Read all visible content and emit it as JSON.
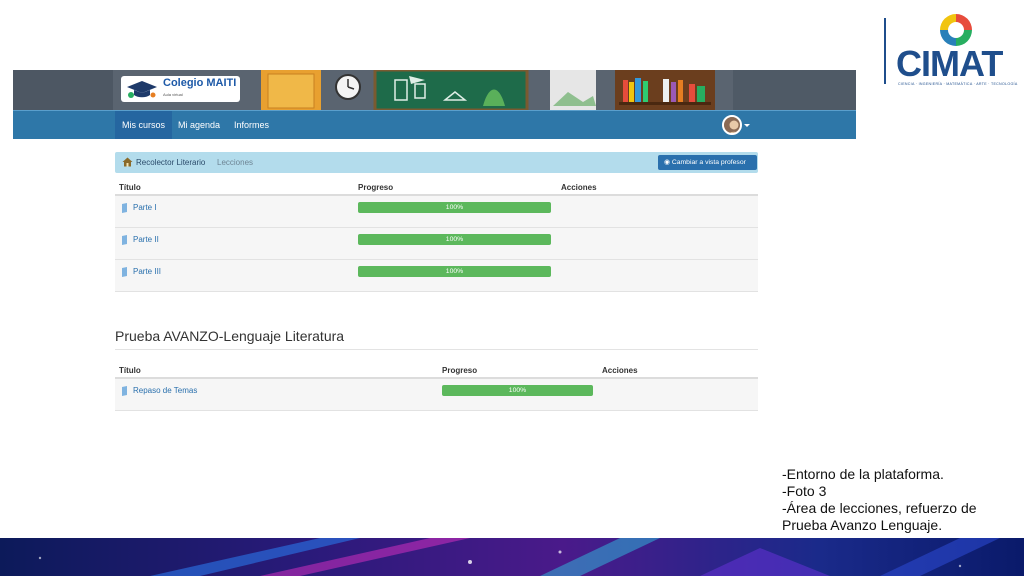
{
  "brand": {
    "logo_text": "CIMAT",
    "tagline": "CIENCIA · INGENIERÍA · MATEMÁTICA · ARTE · TECNOLOGÍA",
    "colors": {
      "primary": "#1f4e8c",
      "nav": "#2e77a8",
      "progress": "#5cb85c",
      "breadcrumb": "#b3dcec"
    }
  },
  "school": {
    "name": "Colegio MAITI",
    "subtitle": "Aula virtual"
  },
  "nav": {
    "items": [
      {
        "label": "Mis cursos",
        "active": true
      },
      {
        "label": "Mi agenda",
        "active": false
      },
      {
        "label": "Informes",
        "active": false
      }
    ]
  },
  "breadcrumb": {
    "home_icon": "home-icon",
    "course": "Recolector Literario",
    "current": "Lecciones",
    "button_icon": "eye-icon",
    "button_label": "Cambiar a vista profesor"
  },
  "lessons_table": {
    "headers": {
      "title": "Título",
      "progress": "Progreso",
      "actions": "Acciones"
    },
    "rows": [
      {
        "title": "Parte I",
        "progress": 100,
        "progress_label": "100%"
      },
      {
        "title": "Parte II",
        "progress": 100,
        "progress_label": "100%"
      },
      {
        "title": "Parte III",
        "progress": 100,
        "progress_label": "100%"
      }
    ]
  },
  "test_section": {
    "title": "Prueba AVANZO-Lenguaje Literatura",
    "headers": {
      "title": "Título",
      "progress": "Progreso",
      "actions": "Acciones"
    },
    "rows": [
      {
        "title": "Repaso de Temas",
        "progress": 100,
        "progress_label": "100%"
      }
    ]
  },
  "notes": [
    "-Entorno de la plataforma.",
    "-Foto 3",
    "-Área de lecciones, refuerzo de",
    "Prueba Avanzo Lenguaje."
  ]
}
